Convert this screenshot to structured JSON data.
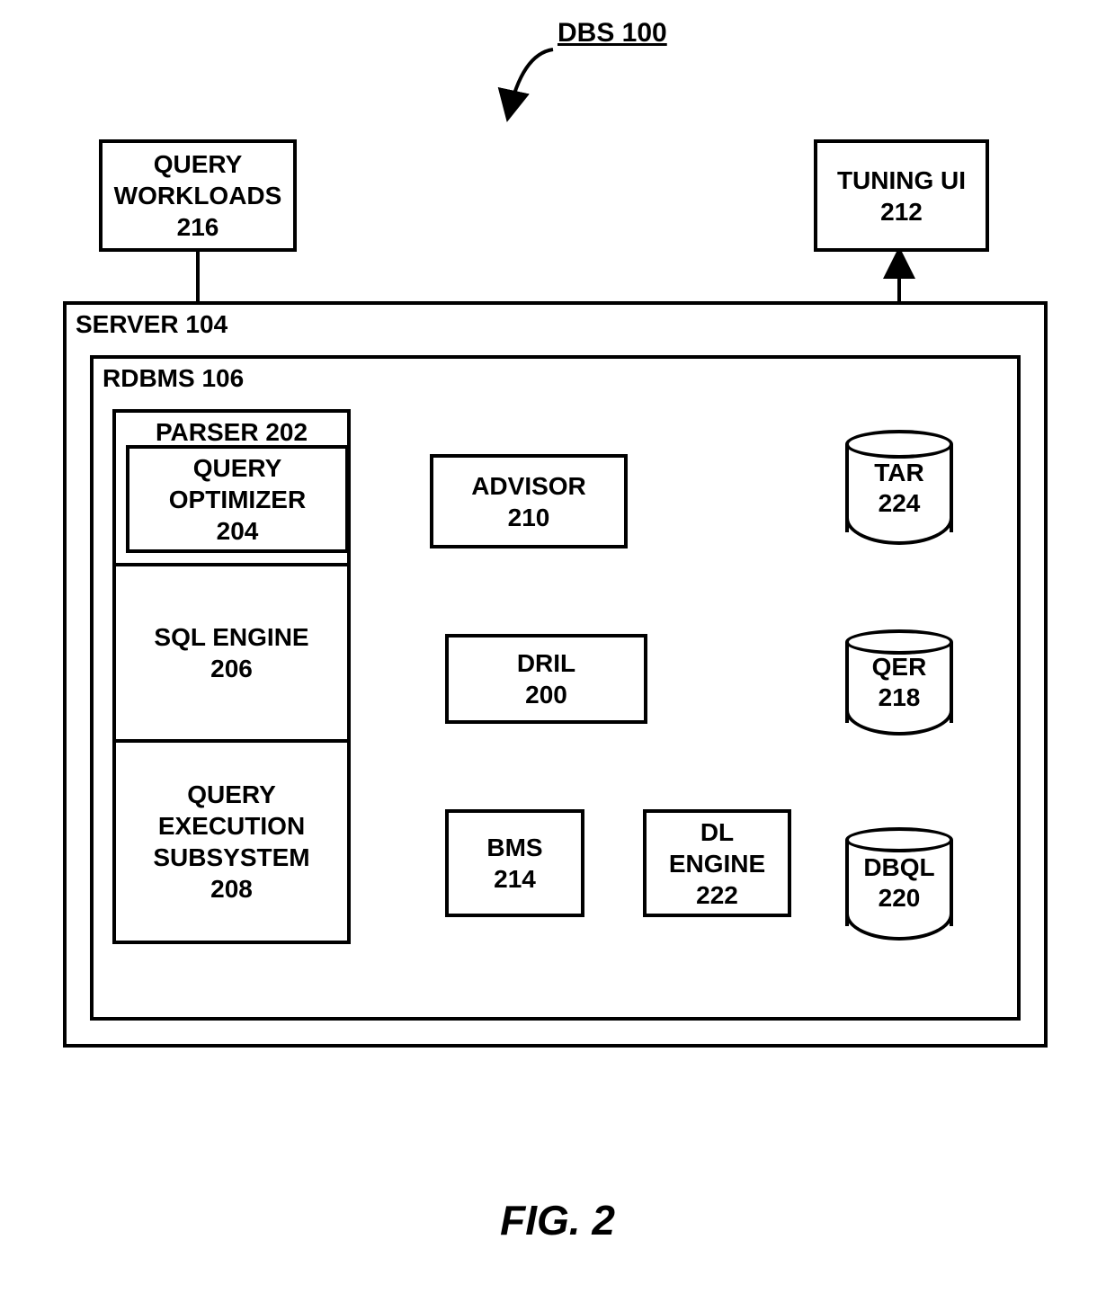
{
  "title": "DBS 100",
  "figure_caption": "FIG. 2",
  "query_workloads": {
    "line1": "QUERY",
    "line2": "WORKLOADS",
    "num": "216"
  },
  "tuning_ui": {
    "line1": "TUNING UI",
    "num": "212"
  },
  "server": {
    "label": "SERVER 104"
  },
  "rdbms": {
    "label": "RDBMS 106"
  },
  "parser": {
    "label": "PARSER 202"
  },
  "query_optimizer": {
    "line1": "QUERY",
    "line2": "OPTIMIZER",
    "num": "204"
  },
  "sql_engine": {
    "line1": "SQL ENGINE",
    "num": "206"
  },
  "query_exec": {
    "line1": "QUERY",
    "line2": "EXECUTION",
    "line3": "SUBSYSTEM",
    "num": "208"
  },
  "advisor": {
    "line1": "ADVISOR",
    "num": "210"
  },
  "dril": {
    "line1": "DRIL",
    "num": "200"
  },
  "bms": {
    "line1": "BMS",
    "num": "214"
  },
  "dl_engine": {
    "line1": "DL",
    "line2": "ENGINE",
    "num": "222"
  },
  "tar": {
    "line1": "TAR",
    "num": "224"
  },
  "qer": {
    "line1": "QER",
    "num": "218"
  },
  "dbql": {
    "line1": "DBQL",
    "num": "220"
  }
}
